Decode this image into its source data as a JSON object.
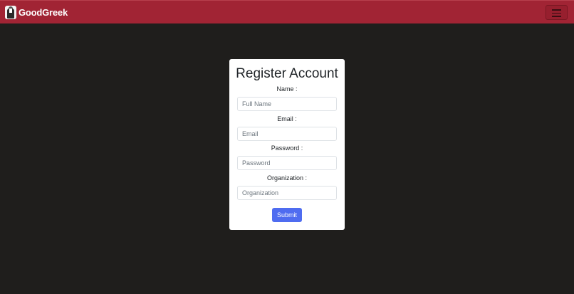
{
  "navbar": {
    "brand": "GoodGreek",
    "logo_icon": "greek-man-logo-icon",
    "toggler_icon": "hamburger-menu-icon",
    "background_color": "#a12434"
  },
  "form": {
    "title": "Register Account",
    "fields": [
      {
        "label": "Name :",
        "placeholder": "Full Name",
        "value": ""
      },
      {
        "label": "Email :",
        "placeholder": "Email",
        "value": ""
      },
      {
        "label": "Password :",
        "placeholder": "Password",
        "value": ""
      },
      {
        "label": "Organization :",
        "placeholder": "Organization",
        "value": ""
      }
    ],
    "submit_label": "Submit",
    "submit_color": "#4f6cf0"
  },
  "page": {
    "background_color": "#1f1e1c"
  }
}
